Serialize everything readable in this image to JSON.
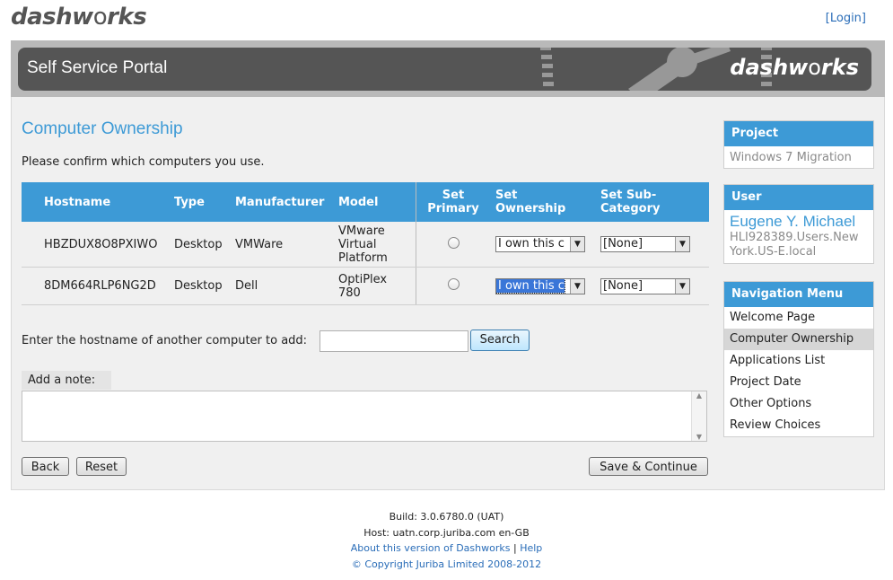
{
  "header": {
    "logo_prefix": "dash",
    "logo_o": "o",
    "logo_w": "w",
    "logo_suffix": "rks",
    "login_link": "[Login]",
    "banner_title": "Self Service Portal"
  },
  "main": {
    "title": "Computer Ownership",
    "intro": "Please confirm which computers you use.",
    "table": {
      "columns": [
        "Hostname",
        "Type",
        "Manufacturer",
        "Model",
        "Set Primary",
        "Set Ownership",
        "Set Sub-Category"
      ],
      "rows": [
        {
          "hostname": "HBZDUX8O8PXIWO",
          "type": "Desktop",
          "manufacturer": "VMWare",
          "model": "VMware Virtual Platform",
          "ownership": "I own this c",
          "subcategory": "[None]"
        },
        {
          "hostname": "8DM664RLP6NG2D",
          "type": "Desktop",
          "manufacturer": "Dell",
          "model": "OptiPlex 780",
          "ownership": "I own this c",
          "subcategory": "[None]"
        }
      ]
    },
    "add_label": "Enter the hostname of another computer to add:",
    "add_input_value": "",
    "search_button": "Search",
    "note_label": "Add a note:",
    "note_value": "",
    "back_button": "Back",
    "reset_button": "Reset",
    "save_button": "Save & Continue"
  },
  "sidebar": {
    "project_heading": "Project",
    "project_value": "Windows 7 Migration",
    "user_heading": "User",
    "user_name": "Eugene Y. Michael",
    "user_host": "HLI928389.Users.New York.US-E.local",
    "nav_heading": "Navigation Menu",
    "nav_items": [
      "Welcome Page",
      "Computer Ownership",
      "Applications List",
      "Project Date",
      "Other Options",
      "Review Choices"
    ],
    "active_nav": "Computer Ownership"
  },
  "footer": {
    "build": "Build: 3.0.6780.0 (UAT)",
    "host": "Host: uatn.corp.juriba.com en-GB",
    "about_link": "About this version of Dashworks",
    "separator": "|",
    "help_link": "Help",
    "copyright": "© Copyright Juriba Limited 2008-2012"
  },
  "colors": {
    "accent": "#3d9ad6",
    "banner": "#555555",
    "link": "#2a6db8"
  },
  "icons": {
    "dropdown": "chevron-down-icon",
    "scroll_up": "scroll-up-icon",
    "scroll_down": "scroll-down-icon"
  }
}
